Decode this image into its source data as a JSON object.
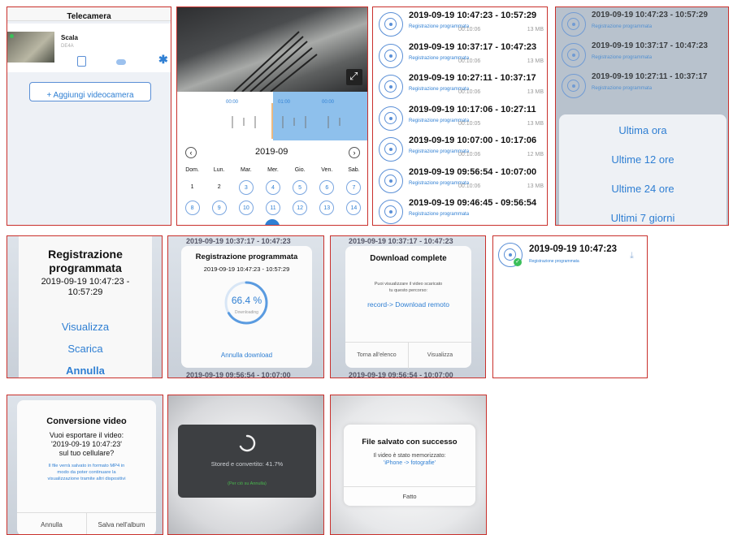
{
  "panel1": {
    "title": "Telecamera",
    "camera_name": "Scala",
    "camera_status": "DE4A",
    "add_button": "+ Aggiungi videocamera"
  },
  "panel2": {
    "time_labels": [
      "00:00",
      "01:00",
      "00:00"
    ],
    "month": "2019-09",
    "weekdays": [
      "Dom.",
      "Lun.",
      "Mar.",
      "Mer.",
      "Gio.",
      "Ven.",
      "Sab."
    ],
    "week1": [
      "1",
      "2",
      "3",
      "4",
      "5",
      "6",
      "7"
    ],
    "week2": [
      "8",
      "9",
      "10",
      "11",
      "12",
      "13",
      "14"
    ]
  },
  "panel3": {
    "records": [
      {
        "time": "2019-09-19  10:47:23 - 10:57:29",
        "dur": "00:10:06",
        "size": "13 MB"
      },
      {
        "time": "2019-09-19  10:37:17 - 10:47:23",
        "dur": "00:10:06",
        "size": "13 MB"
      },
      {
        "time": "2019-09-19  10:27:11 - 10:37:17",
        "dur": "00:10:06",
        "size": "13 MB"
      },
      {
        "time": "2019-09-19  10:17:06 - 10:27:11",
        "dur": "00:10:05",
        "size": "13 MB"
      },
      {
        "time": "2019-09-19  10:07:00 - 10:17:06",
        "dur": "00:10:06",
        "size": "12 MB"
      },
      {
        "time": "2019-09-19  09:56:54 - 10:07:00",
        "dur": "00:10:06",
        "size": "13 MB"
      },
      {
        "time": "2019-09-19  09:46:45 - 09:56:54",
        "dur": "",
        "size": ""
      }
    ],
    "rec_sub": "Registrazione programmata"
  },
  "panel4": {
    "records": [
      {
        "time": "2019-09-19  10:47:23 - 10:57:29"
      },
      {
        "time": "2019-09-19  10:37:17 - 10:47:23"
      },
      {
        "time": "2019-09-19  10:27:11 - 10:37:17"
      }
    ],
    "options": [
      "Ultima ora",
      "Ultime 12 ore",
      "Ultime 24 ore",
      "Ultimi 7 giorni"
    ]
  },
  "panel5": {
    "title_line1": "Registrazione",
    "title_line2": "programmata",
    "datetime_line1": "2019-09-19  10:47:23 -",
    "datetime_line2": "10:57:29",
    "view": "Visualizza",
    "download": "Scarica",
    "cancel": "Annulla"
  },
  "panel6": {
    "bg_top": "2019-09-19  10:37:17 - 10:47:23",
    "bg_bottom": "2019-09-19  09:56:54 - 10:07:00",
    "title": "Registrazione programmata",
    "datetime": "2019-09-19  10:47:23 - 10:57:29",
    "percent": "66.4 %",
    "progress": 0.664,
    "status": "Downloading",
    "cancel": "Annulla download"
  },
  "panel7": {
    "bg_top": "2019-09-19  10:37:17 - 10:47:23",
    "bg_bottom": "2019-09-19  09:56:54 - 10:07:00",
    "title": "Download complete",
    "message_line1": "Puoi visualizzare il video scaricato",
    "message_line2": "tu questo percorso:",
    "path": "record-> Download remoto",
    "back": "Torna all'elenco",
    "view": "Visualizza"
  },
  "panel8": {
    "datetime": "2019-09-19  10:47:23",
    "sub": "Registrazione programmata"
  },
  "panel9": {
    "title": "Conversione video",
    "question_line1": "Vuoi esportare il video:",
    "question_line2": "'2019-09-19  10:47:23'",
    "question_line3": "sul tuo   cellulare?",
    "note_line1": "Il file verrà salvato in formato MP4 in",
    "note_line2": "modo da poter continuare la",
    "note_line3": "visualizzazione tramite altri dispositivi",
    "cancel": "Annulla",
    "save": "Salva nell'album"
  },
  "panel10": {
    "status": "Stored e convertito: 41.7%",
    "progress": 0.417,
    "note": "(Per ciò su Annulla)"
  },
  "panel11": {
    "title": "File salvato con successo",
    "message_line1": "Il video è stato memorizzato:",
    "path": "'iPhone -> fotografie'",
    "done": "Fatto"
  },
  "colors": {
    "border": "#c9302c",
    "accent": "#2f7fd3",
    "timeline_blue": "#8ec0ec",
    "today": "#2f7fd3"
  }
}
